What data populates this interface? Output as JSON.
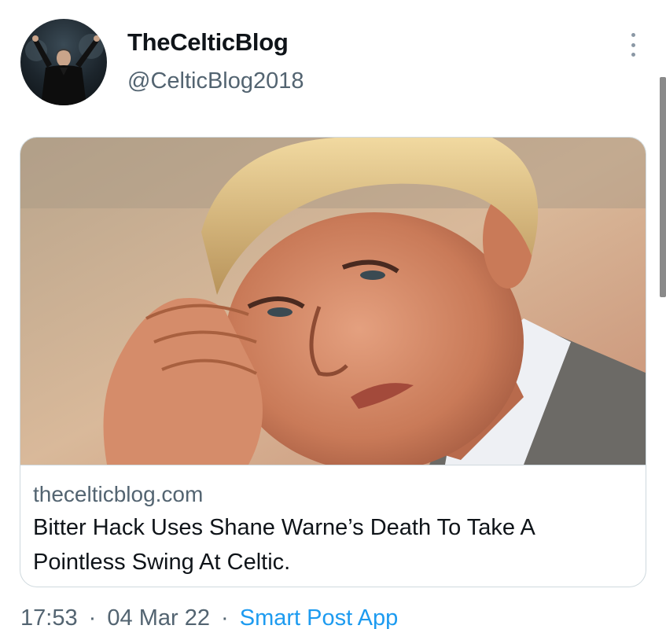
{
  "user": {
    "display_name": "TheCelticBlog",
    "handle": "@CelticBlog2018"
  },
  "more_icon": "more-vertical-icon",
  "card": {
    "domain": "thecelticblog.com",
    "title": "Bitter Hack Uses Shane Warne’s Death To Take A Pointless Swing At Celtic."
  },
  "meta": {
    "time": "17:53",
    "separator": "·",
    "date": "04 Mar 22",
    "source": "Smart Post App"
  },
  "colors": {
    "text_primary": "#0f1419",
    "text_secondary": "#536471",
    "link": "#1d9bf0",
    "border": "#cfd9de"
  }
}
